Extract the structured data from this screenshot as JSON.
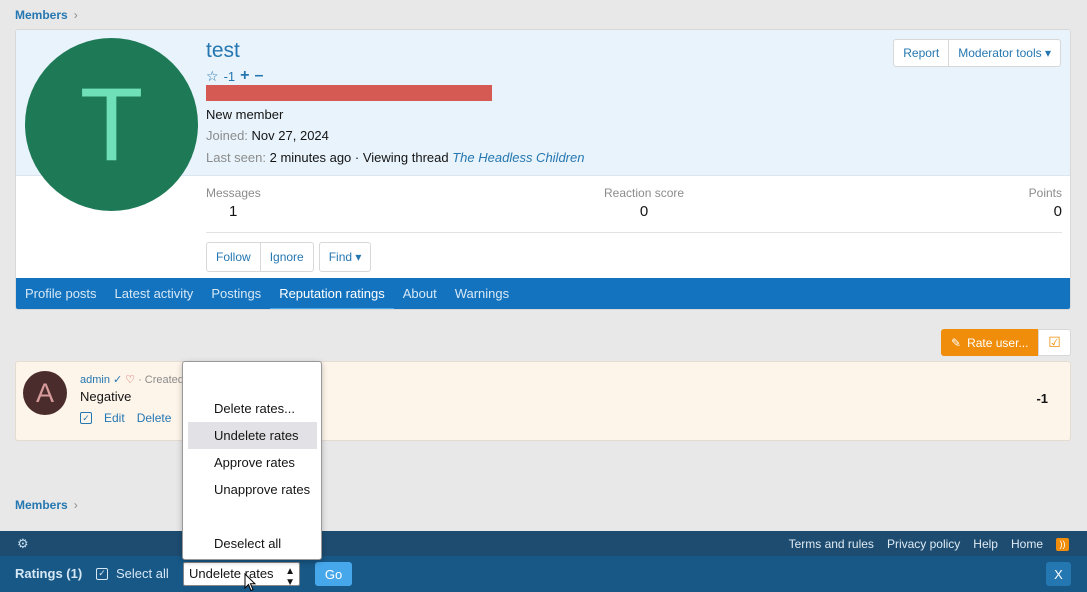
{
  "breadcrumb": {
    "label": "Members"
  },
  "profile": {
    "avatar_letter": "T",
    "username": "test",
    "reputation": "-1",
    "plus": "+",
    "minus": "–",
    "user_title": "New member",
    "joined_label": "Joined:",
    "joined_value": "Nov 27, 2024",
    "last_seen_label": "Last seen:",
    "last_seen_value": "2 minutes ago · Viewing thread",
    "last_seen_thread": "The Headless Children",
    "report_label": "Report",
    "mod_tools_label": "Moderator tools ▾",
    "stats": {
      "messages_label": "Messages",
      "messages_value": "1",
      "reaction_label": "Reaction score",
      "reaction_value": "0",
      "points_label": "Points",
      "points_value": "0"
    },
    "follow_label": "Follow",
    "ignore_label": "Ignore",
    "find_label": "Find ▾",
    "tabs": [
      "Profile posts",
      "Latest activity",
      "Postings",
      "Reputation ratings",
      "About",
      "Warnings"
    ]
  },
  "rate_user_label": "Rate user...",
  "rating": {
    "avatar_letter": "A",
    "author": "admin",
    "created": "· Created",
    "text": "Negative",
    "edit_label": "Edit",
    "delete_label": "Delete",
    "score": "-1"
  },
  "footer": {
    "links": [
      "Terms and rules",
      "Privacy policy",
      "Help",
      "Home"
    ]
  },
  "inline_mod": {
    "title": "Ratings (1)",
    "select_all_label": "Select all",
    "selected_action": "Undelete rates",
    "go_label": "Go",
    "close_label": "X"
  },
  "dropdown": {
    "options": [
      "Delete rates...",
      "Undelete rates",
      "Approve rates",
      "Unapprove rates",
      "Deselect all"
    ],
    "highlighted": "Undelete rates"
  },
  "colors": {
    "accent": "#2577b1",
    "tab_bar": "#1473be",
    "rep_bar": "#d45a53",
    "rate_button": "#f08d0a"
  }
}
